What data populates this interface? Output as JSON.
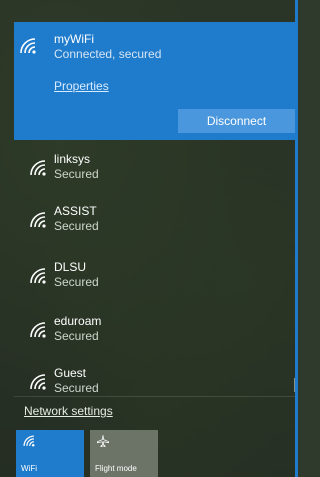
{
  "connected": {
    "name": "myWiFi",
    "status": "Connected, secured",
    "properties_label": "Properties",
    "disconnect_label": "Disconnect"
  },
  "networks": [
    {
      "name": "linksys",
      "status": "Secured"
    },
    {
      "name": "ASSIST",
      "status": "Secured"
    },
    {
      "name": "DLSU",
      "status": "Secured"
    },
    {
      "name": "eduroam",
      "status": "Secured"
    },
    {
      "name": "Guest",
      "status": "Secured"
    }
  ],
  "network_settings_label": "Network settings",
  "quick_actions": [
    {
      "label": "WiFi",
      "icon": "wifi-icon",
      "active": true
    },
    {
      "label": "Flight mode",
      "icon": "airplane-icon",
      "active": false
    }
  ],
  "colors": {
    "accent": "#1f7bcc",
    "button": "#4a97dd",
    "panel": "#242c22"
  }
}
